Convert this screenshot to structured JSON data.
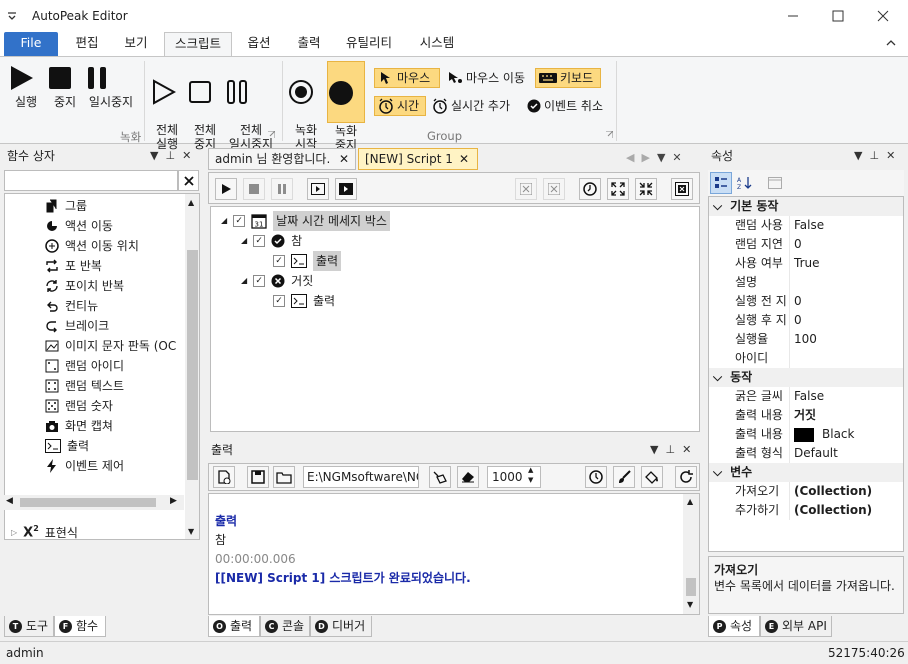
{
  "window": {
    "title": "AutoPeak Editor"
  },
  "menu": {
    "file": "File",
    "tabs": [
      "편집",
      "보기",
      "스크립트",
      "옵션",
      "출력",
      "유틸리티",
      "시스템"
    ]
  },
  "ribbon": {
    "run": "실행",
    "stop": "중지",
    "pause": "일시중지",
    "run_all": "전체\n실행",
    "stop_all": "전체\n중지",
    "pause_all": "전체\n일시중지",
    "group_record": "녹화",
    "rec_start": "녹화\n시작",
    "rec_stop": "녹화\n중지",
    "mouse": "마우스",
    "mouse_move": "마우스 이동",
    "keyboard": "키보드",
    "time": "시간",
    "realtime_add": "실시간 추가",
    "event_cancel": "이벤트 취소",
    "group_group": "Group"
  },
  "func_box": {
    "title": "함수 상자",
    "search_value": "",
    "items": [
      "그룹",
      "액션 이동",
      "액션 이동 위치",
      "포 반복",
      "포이치 반복",
      "컨티뉴",
      "브레이크",
      "이미지 문자 판독 (OC",
      "랜덤 아이디",
      "랜덤 텍스트",
      "랜덤 숫자",
      "화면 캡쳐",
      "출력",
      "이벤트 제어"
    ],
    "category": "표현식",
    "tabs": {
      "tools": "도구",
      "functions": "함수"
    }
  },
  "editor": {
    "tabs": [
      "admin 님 환영합니다.",
      "[NEW] Script 1"
    ],
    "tree": {
      "root": "날짜 시간 메세지 박스",
      "true_label": "참",
      "output1": "출력",
      "false_label": "거짓",
      "output2": "출력"
    }
  },
  "output": {
    "title": "출력",
    "path": "E:\\NGMsoftware\\NG",
    "count": "1000",
    "lines": [
      {
        "text": "출력",
        "color": "#1a2aa8"
      },
      {
        "text": "참",
        "color": "#1e1e1e"
      },
      {
        "text": "00:00:00.006",
        "color": "#888888"
      },
      {
        "text": "[[NEW] Script 1] 스크립트가 완료되었습니다.",
        "color": "#1a2aa8"
      }
    ],
    "tabs": {
      "output": "출력",
      "console": "콘솔",
      "debugger": "디버거"
    }
  },
  "properties": {
    "title": "속성",
    "cat_basic": "기본 동작",
    "basic": [
      {
        "k": "랜덤 사용",
        "v": "False"
      },
      {
        "k": "랜덤 지연",
        "v": "0"
      },
      {
        "k": "사용 여부",
        "v": "True"
      },
      {
        "k": "설명",
        "v": ""
      },
      {
        "k": "실행 전 지",
        "v": "0"
      },
      {
        "k": "실행 후 지",
        "v": "0"
      },
      {
        "k": "실행율",
        "v": "100"
      },
      {
        "k": "아이디",
        "v": ""
      }
    ],
    "cat_action": "동작",
    "action": [
      {
        "k": "굵은 글씨",
        "v": "False"
      },
      {
        "k": "출력 내용",
        "v": "거짓"
      },
      {
        "k": "출력 내용",
        "v": "Black"
      },
      {
        "k": "출력 형식",
        "v": "Default"
      }
    ],
    "cat_var": "변수",
    "var": [
      {
        "k": "가져오기",
        "v": "(Collection)"
      },
      {
        "k": "추가하기",
        "v": "(Collection)"
      }
    ],
    "desc_title": "가져오기",
    "desc_text": "변수 목록에서 데이터를 가져옵니다.",
    "tabs": {
      "properties": "속성",
      "external_api": "외부 API"
    }
  },
  "statusbar": {
    "user": "admin",
    "time": "52175:40:26"
  },
  "colors": {
    "accent": "#3272c9",
    "highlight": "#fcd980",
    "selected_tab": "#fff3c4"
  }
}
